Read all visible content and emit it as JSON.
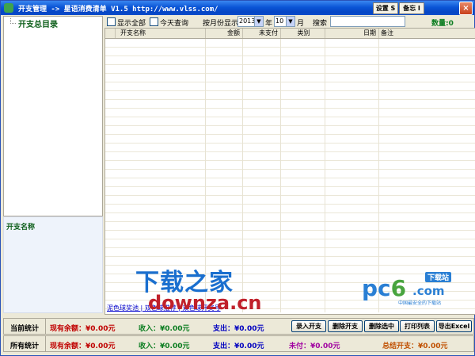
{
  "window": {
    "title": "开支管理 -> 星语消费清单 V1.5 http://www.vlss.com/",
    "settings_button": "设置 S",
    "memo_button": "备忘 I",
    "close_label": "×"
  },
  "tree": {
    "root_label": "开支总目录"
  },
  "detail": {
    "title": "开支名称"
  },
  "toolbar": {
    "show_all_label": "显示全部",
    "today_label": "今天查询",
    "by_month_label": "按月份显示",
    "year_value": "2013",
    "year_label": "年",
    "month_value": "10",
    "month_label": "月",
    "search_label": "搜索",
    "search_value": "",
    "count_text": "数量:0"
  },
  "grid": {
    "columns": [
      "",
      "开支名称",
      "金额",
      "未支付",
      "类别",
      "日期",
      "备注"
    ],
    "footer_link": "泥色球奖池 | 双色球推荐 | 双色球开奖号"
  },
  "watermark": {
    "line1": "下载之家",
    "line2": "downza.cn",
    "pc6_text": "pc",
    "pc6_six": "6",
    "pc6_com": ".com",
    "pc6_badge": "下载站",
    "pc6_tagline": "中国最安全的下载站"
  },
  "current_stats": {
    "label": "当前统计",
    "balance": "现有余额：¥0.00元",
    "income": "收入：¥0.00元",
    "expense": "支出：¥0.00元"
  },
  "all_stats": {
    "label": "所有统计",
    "balance": "现有余额：¥0.00元",
    "income": "收入：¥0.00元",
    "expense": "支出：¥0.00元",
    "unpaid": "未付：¥0.00元",
    "total": "总结开支：¥0.00元"
  },
  "actions": {
    "add": "录入开支",
    "delete": "删除开支",
    "delete_selected": "删除选中",
    "print": "打印列表",
    "export": "导出Excel"
  },
  "colors": {
    "titlebar": "#0a55d6",
    "balance_red": "#c00000",
    "income_green": "#0b7d20",
    "expense_blue": "#0000c0",
    "unpaid_purple": "#a000a0",
    "total_orange": "#c05000"
  }
}
